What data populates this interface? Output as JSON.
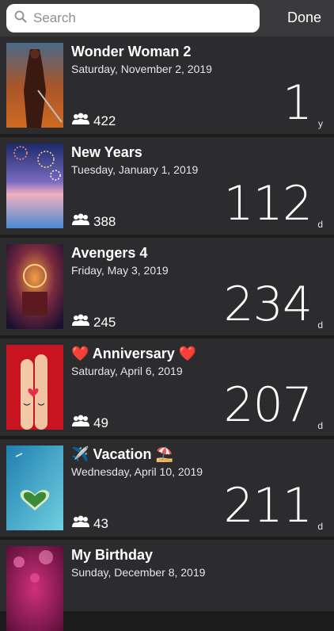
{
  "search": {
    "placeholder": "Search"
  },
  "done_label": "Done",
  "events": [
    {
      "emoji_before": "",
      "title": "Wonder Woman 2",
      "emoji_after": "",
      "date": "Saturday, November 2, 2019",
      "guests": "422",
      "count": "1",
      "unit": "y",
      "thumb": "wonder-woman"
    },
    {
      "emoji_before": "",
      "title": "New Years",
      "emoji_after": "",
      "date": "Tuesday, January 1, 2019",
      "guests": "388",
      "count": "112",
      "unit": "d",
      "thumb": "fireworks"
    },
    {
      "emoji_before": "",
      "title": "Avengers 4",
      "emoji_after": "",
      "date": "Friday, May 3, 2019",
      "guests": "245",
      "count": "234",
      "unit": "d",
      "thumb": "avengers"
    },
    {
      "emoji_before": "❤️",
      "title": "Anniversary",
      "emoji_after": "❤️",
      "date": "Saturday, April 6, 2019",
      "guests": "49",
      "count": "207",
      "unit": "d",
      "thumb": "fingers-heart"
    },
    {
      "emoji_before": "✈️",
      "title": "Vacation",
      "emoji_after": "⛱️",
      "date": "Wednesday, April 10, 2019",
      "guests": "43",
      "count": "211",
      "unit": "d",
      "thumb": "island"
    },
    {
      "emoji_before": "",
      "title": "My Birthday",
      "emoji_after": "",
      "date": "Sunday, December 8, 2019",
      "guests": "",
      "count": "",
      "unit": "",
      "thumb": "bokeh"
    }
  ]
}
